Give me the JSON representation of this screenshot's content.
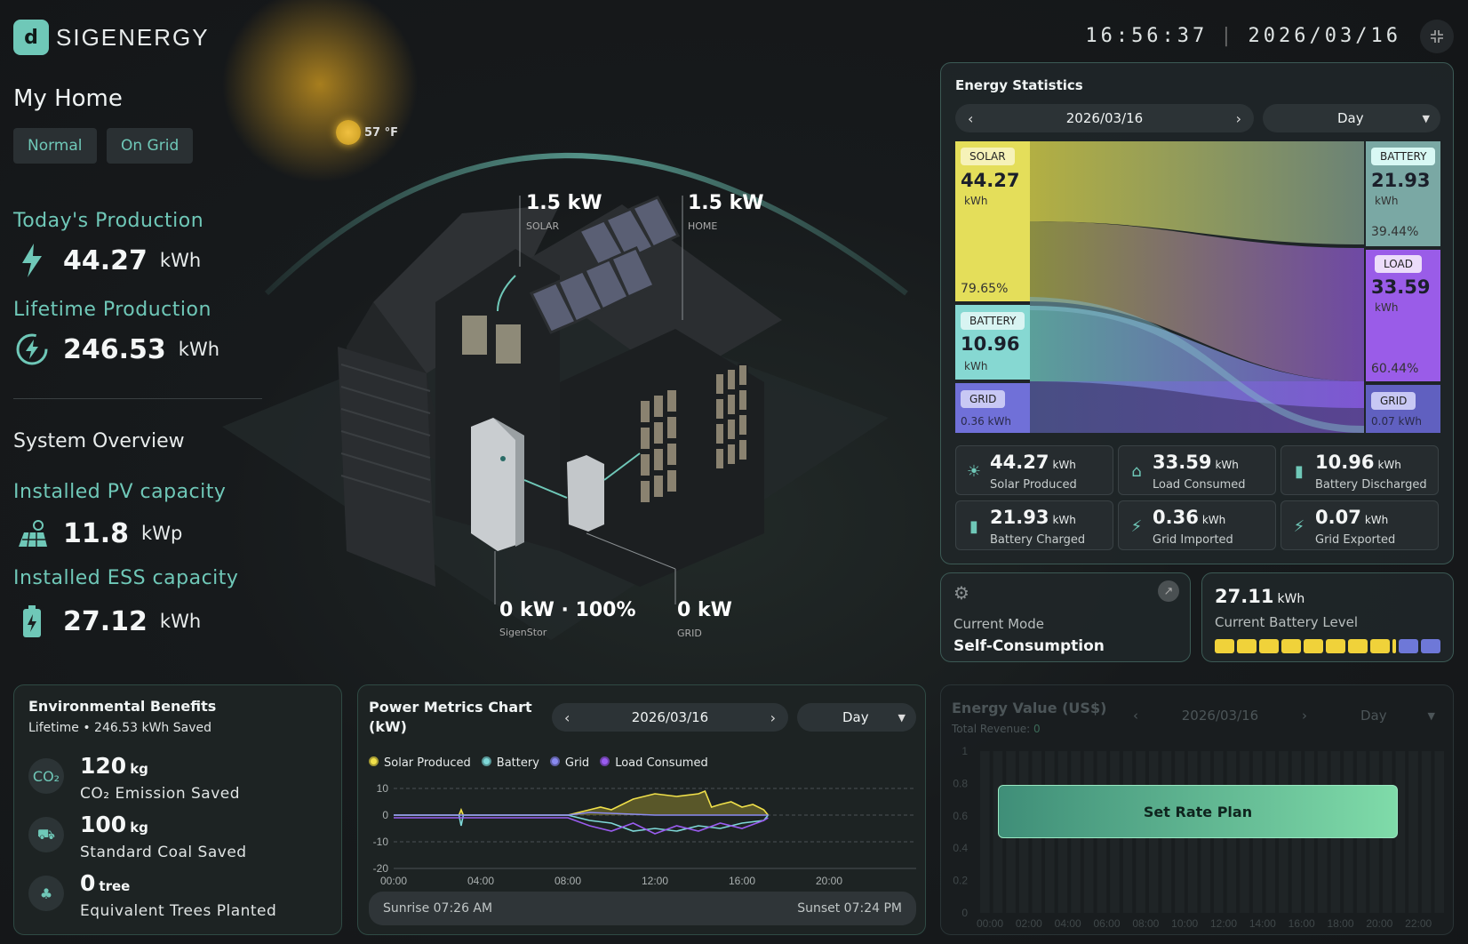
{
  "brand": {
    "name": "SIGENERGY",
    "logo_letter": "d"
  },
  "clock": {
    "time": "16:56:37",
    "separator": "|",
    "date": "2026/03/16"
  },
  "home": {
    "title": "My Home",
    "tags": [
      "Normal",
      "On Grid"
    ]
  },
  "weather": {
    "temp": "57 °F"
  },
  "production": {
    "today_label": "Today's Production",
    "today_value": "44.27",
    "today_unit": "kWh",
    "lifetime_label": "Lifetime Production",
    "lifetime_value": "246.53",
    "lifetime_unit": "kWh"
  },
  "system": {
    "title": "System Overview",
    "pv_label": "Installed PV capacity",
    "pv_value": "11.8",
    "pv_unit": "kWp",
    "ess_label": "Installed ESS capacity",
    "ess_value": "27.12",
    "ess_unit": "kWh"
  },
  "house": {
    "solar_value": "1.5 kW",
    "solar_label": "SOLAR",
    "home_value": "1.5 kW",
    "home_label": "HOME",
    "sigenstor_value": "0 kW · 100%",
    "sigenstor_label": "SigenStor",
    "grid_value": "0 kW",
    "grid_label": "GRID"
  },
  "energy_stats": {
    "title": "Energy Statistics",
    "date": "2026/03/16",
    "period": "Day",
    "sankey": {
      "solar": {
        "tag": "SOLAR",
        "value": "44.27",
        "unit": "kWh",
        "pct": "79.65%"
      },
      "battery_in": {
        "tag": "BATTERY",
        "value": "10.96",
        "unit": "kWh"
      },
      "grid_in": {
        "tag": "GRID",
        "value": "0.36 kWh"
      },
      "battery_out": {
        "tag": "BATTERY",
        "value": "21.93",
        "unit": "kWh",
        "pct": "39.44%"
      },
      "load": {
        "tag": "LOAD",
        "value": "33.59",
        "unit": "kWh",
        "pct": "60.44%"
      },
      "grid_out": {
        "tag": "GRID",
        "value": "0.07 kWh"
      }
    },
    "cards": [
      {
        "value": "44.27",
        "unit": "kWh",
        "label": "Solar Produced",
        "icon": "solar-panel-icon"
      },
      {
        "value": "33.59",
        "unit": "kWh",
        "label": "Load Consumed",
        "icon": "home-icon"
      },
      {
        "value": "10.96",
        "unit": "kWh",
        "label": "Battery Discharged",
        "icon": "battery-discharge-icon"
      },
      {
        "value": "21.93",
        "unit": "kWh",
        "label": "Battery Charged",
        "icon": "battery-charge-icon"
      },
      {
        "value": "0.36",
        "unit": "kWh",
        "label": "Grid Imported",
        "icon": "grid-import-icon"
      },
      {
        "value": "0.07",
        "unit": "kWh",
        "label": "Grid Exported",
        "icon": "grid-export-icon"
      }
    ]
  },
  "mode": {
    "label": "Current Mode",
    "value": "Self-Consumption"
  },
  "battery_level": {
    "value": "27.11",
    "unit": "kWh",
    "label": "Current Battery Level",
    "cells_filled": 8,
    "cells_total": 10
  },
  "env": {
    "title": "Environmental Benefits",
    "subtitle": "Lifetime",
    "saved": "• 246.53 kWh Saved",
    "items": [
      {
        "value": "120",
        "unit": "kg",
        "label": "CO₂ Emission Saved",
        "icon": "co2-icon"
      },
      {
        "value": "100",
        "unit": "kg",
        "label": "Standard Coal Saved",
        "icon": "coal-cart-icon"
      },
      {
        "value": "0",
        "unit": "tree",
        "label": "Equivalent Trees Planted",
        "icon": "tree-icon"
      }
    ]
  },
  "power": {
    "title": "Power Metrics Chart",
    "title_unit": "(kW)",
    "date": "2026/03/16",
    "period": "Day",
    "legend": [
      {
        "name": "Solar Produced",
        "color": "#f0e04a"
      },
      {
        "name": "Battery",
        "color": "#7fd8d8"
      },
      {
        "name": "Grid",
        "color": "#8a8af0"
      },
      {
        "name": "Load Consumed",
        "color": "#9a5cf0"
      }
    ],
    "sunrise": "Sunrise 07:26 AM",
    "sunset": "Sunset 07:24 PM"
  },
  "chart_data": {
    "type": "line",
    "title": "Power Metrics Chart (kW)",
    "x_ticks": [
      "00:00",
      "04:00",
      "08:00",
      "12:00",
      "16:00",
      "20:00"
    ],
    "y_ticks": [
      10,
      0,
      -10,
      -20
    ],
    "ylim": [
      -20,
      10
    ],
    "xlim_hours": [
      0,
      24
    ],
    "series": [
      {
        "name": "Solar Produced",
        "x": [
          0,
          3,
          3.1,
          3.2,
          6,
          8,
          9,
          9.5,
          10,
          11,
          12,
          13,
          14,
          14.3,
          14.6,
          15,
          15.5,
          16,
          16.5,
          17,
          17.2
        ],
        "y": [
          0,
          0,
          2,
          0,
          0,
          0,
          2,
          3,
          2,
          6,
          8,
          7,
          8,
          9,
          3,
          4,
          5,
          3,
          4,
          2,
          0
        ]
      },
      {
        "name": "Battery",
        "x": [
          0,
          3,
          3.1,
          3.2,
          6,
          8,
          9,
          10,
          11,
          12,
          13,
          14,
          15,
          16,
          17,
          17.2
        ],
        "y": [
          0,
          0,
          -4,
          0,
          0,
          0,
          -2,
          -3,
          -6,
          -5,
          -6,
          -4,
          -5,
          -3,
          -2,
          0
        ]
      },
      {
        "name": "Grid",
        "x": [
          0,
          6,
          8,
          9,
          12,
          15,
          17,
          17.2
        ],
        "y": [
          0,
          0,
          0,
          1,
          0,
          0,
          0,
          0
        ]
      },
      {
        "name": "Load Consumed",
        "x": [
          0,
          6,
          8,
          9,
          10,
          11,
          12,
          13,
          14,
          15,
          16,
          17,
          17.2
        ],
        "y": [
          -1,
          -1,
          -1,
          -4,
          -6,
          -3,
          -7,
          -4,
          -6,
          -3,
          -5,
          -2,
          -1
        ]
      }
    ]
  },
  "value": {
    "title": "Energy Value (US$)",
    "date": "2026/03/16",
    "period": "Day",
    "revenue_label": "Total Revenue:",
    "revenue_value": "0",
    "y_ticks": [
      "1",
      "0.8",
      "0.6",
      "0.4",
      "0.2",
      "0"
    ],
    "x_ticks": [
      "00:00",
      "02:00",
      "04:00",
      "06:00",
      "08:00",
      "10:00",
      "12:00",
      "14:00",
      "16:00",
      "18:00",
      "20:00",
      "22:00"
    ],
    "button": "Set Rate Plan"
  }
}
